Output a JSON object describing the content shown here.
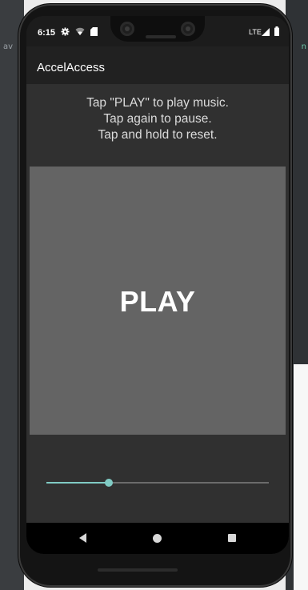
{
  "background": {
    "left_text": "av",
    "right_text": "n"
  },
  "status_bar": {
    "time": "6:15",
    "network": "LTE",
    "icons": [
      "gear-icon",
      "wifi-icon",
      "sd-card-icon",
      "signal-icon",
      "battery-icon"
    ]
  },
  "app_bar": {
    "title": "AccelAccess"
  },
  "instructions": {
    "line1": "Tap \"PLAY\" to play music.",
    "line2": "Tap again to pause.",
    "line3": "Tap and hold to reset."
  },
  "play_button": {
    "label": "PLAY"
  },
  "slider": {
    "value_fraction": 0.28
  },
  "colors": {
    "accent": "#80cbc4",
    "panel": "#646464",
    "content_bg": "#303030",
    "app_bar_bg": "#212121"
  }
}
